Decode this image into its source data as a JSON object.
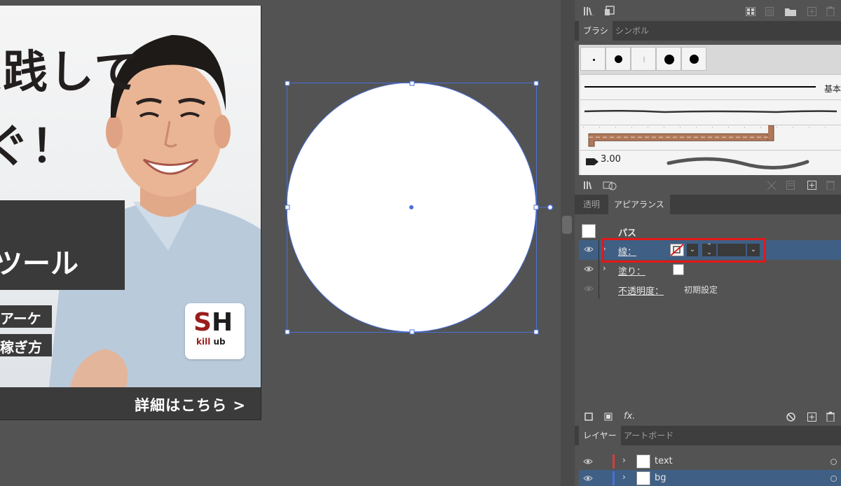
{
  "artboard": {
    "headline_line1": "実践して",
    "headline_line2": "ぐ！",
    "dark_box_text": "ツール",
    "tag1": "アーケ",
    "tag2": "稼ぎ方",
    "detail_link": "詳細はこちら >",
    "logo": {
      "main_s": "S",
      "main_h": "H",
      "sub_red": "kill",
      "sub_dark": " ub"
    }
  },
  "top_toolbar": {
    "icons": [
      "library-icon",
      "place-icon",
      "tile-icon",
      "list-icon",
      "folder-icon",
      "add-icon",
      "trash-icon"
    ]
  },
  "brush_panel": {
    "tabs": [
      {
        "label": "ブラシ",
        "active": true
      },
      {
        "label": "シンボル",
        "active": false
      }
    ],
    "basic_label": "基本",
    "size_label": "3.00"
  },
  "appearance_panel": {
    "tabs": [
      {
        "label": "透明",
        "active": false
      },
      {
        "label": "アピアランス",
        "active": true
      }
    ],
    "title": "パス",
    "rows": [
      {
        "label": "線：",
        "value": ""
      },
      {
        "label": "塗り：",
        "value": ""
      },
      {
        "label": "不透明度：",
        "value": "初期設定"
      }
    ]
  },
  "layers_panel": {
    "tabs": [
      {
        "label": "レイヤー",
        "active": true
      },
      {
        "label": "アートボード",
        "active": false
      }
    ],
    "layers": [
      {
        "name": "text",
        "color": "#d83c3c"
      },
      {
        "name": "bg",
        "color": "#4a6fd8"
      }
    ]
  },
  "colors": {
    "selection": "#4a6fd8",
    "highlight": "#e31818",
    "panel_bg": "#535353",
    "selected_row": "#3f5f85"
  }
}
